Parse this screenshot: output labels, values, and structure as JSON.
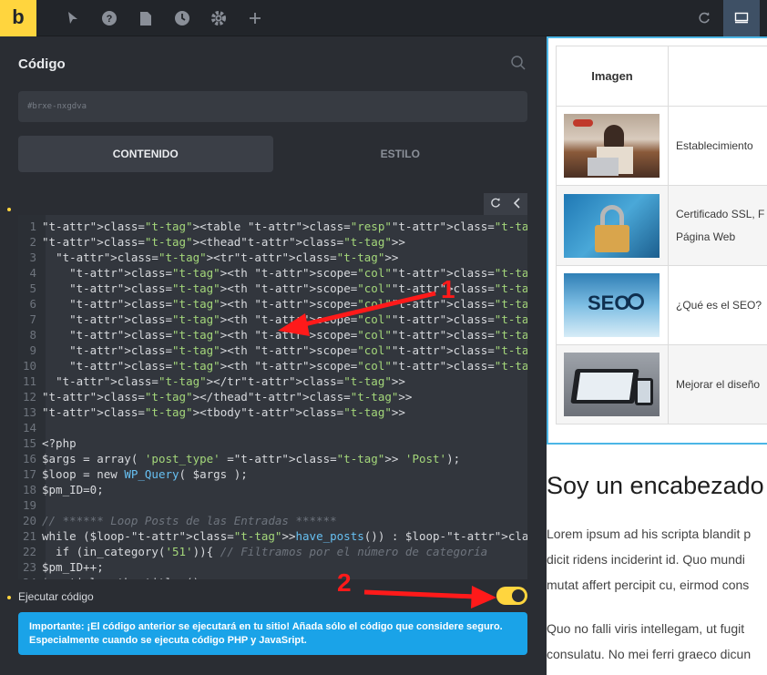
{
  "toolbar": {
    "logo": "b",
    "icons": [
      "pointer-icon",
      "help-icon",
      "pages-icon",
      "history-icon",
      "settings-icon",
      "plus-icon"
    ],
    "right_icons": [
      "refresh-icon",
      "desktop-icon"
    ]
  },
  "panel": {
    "title": "Código",
    "element_id": "#brxe-nxgdva",
    "tabs": [
      {
        "label": "CONTENIDO",
        "active": true
      },
      {
        "label": "ESTILO",
        "active": false
      }
    ],
    "execute_label": "Ejecutar código",
    "execute_enabled": true,
    "notice": "Importante: ¡El código anterior se ejecutará en tu sitio! Añada sólo el código que considere seguro. Especialmente cuando se ejecuta código PHP y JavaSript."
  },
  "code_lines": [
    "<table class=\"resp\">",
    "<thead>",
    "  <tr>",
    "    <th scope=\"col\">Imagen</th>",
    "    <th scope=\"col\">Titulo</th>",
    "    <th scope=\"col\">Fecha</th>",
    "    <th scope=\"col\">Hora</th>",
    "    <th scope=\"col\">Aforo</th>",
    "    <th scope=\"col\">Tipo Evento</th>",
    "    <th scope=\"col\">Acción</th>",
    "  </tr>",
    "</thead>",
    "<tbody>",
    "",
    "<?php",
    "$args = array( 'post_type' => 'Post');",
    "$loop = new WP_Query( $args );",
    "$pm_ID=0;",
    "",
    "// ****** Loop Posts de las Entradas ******",
    "while ($loop->have_posts()) : $loop->the_post();",
    "  if (in_category('51')){ // Filtramos por el número de categoría",
    "$pm_ID++;",
    "$   ti l   th  titl  ()"
  ],
  "annotations": [
    "1",
    "2"
  ],
  "colors": {
    "accent": "#ffd53e",
    "notice": "#1aa3e8",
    "arrow": "#ff1a1a",
    "preview_border": "#4cb6e6"
  },
  "preview": {
    "table_header": "Imagen",
    "rows": [
      {
        "title": "Establecimiento "
      },
      {
        "title_line1": "Certificado SSL, F",
        "title_line2": "Página Web"
      },
      {
        "title": "¿Qué es el SEO?"
      },
      {
        "title": "Mejorar el diseño"
      }
    ],
    "heading": "Soy un encabezado",
    "paragraph1": [
      "Lorem ipsum ad his scripta blandit p",
      "dicit ridens inciderint id. Quo mundi",
      "mutat affert percipit cu, eirmod cons"
    ],
    "paragraph2": [
      "Quo no falli viris intellegam, ut fugit",
      "consulatu. No mei ferri graeco dicun"
    ]
  }
}
